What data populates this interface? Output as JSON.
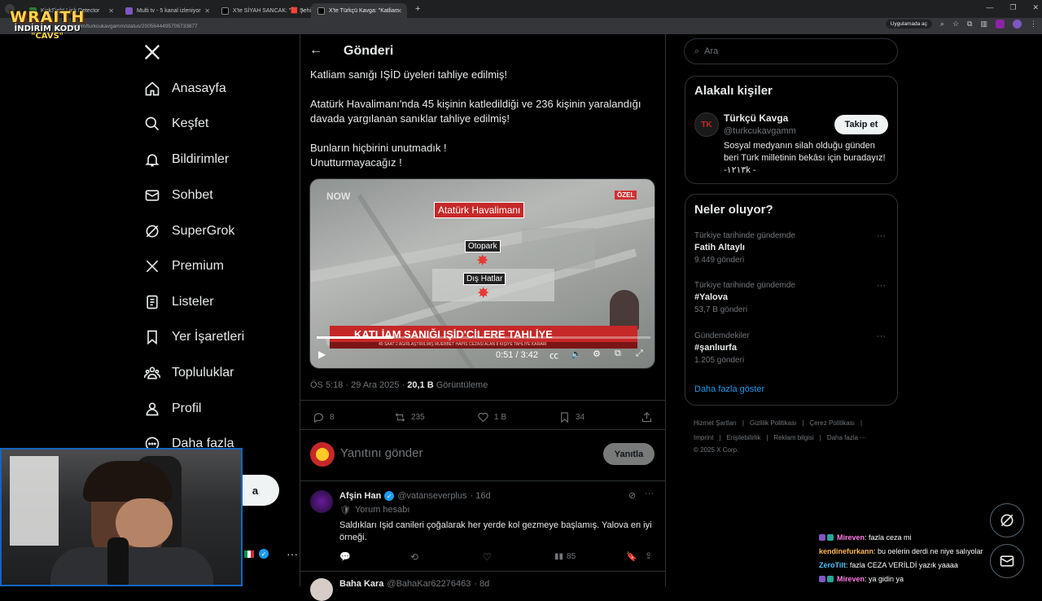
{
  "browser": {
    "tabs": [
      {
        "title": "KickSight Link Detector",
        "color": "#2e7d32"
      },
      {
        "title": "Multi tv - 5 kanal izleniyor",
        "color": "#7e57c2"
      },
      {
        "title": "X'te SİYAH SANCAK: \"🟥 Şehit",
        "color": "#000000"
      },
      {
        "title": "X'te Türkçü Kavga: \"Katliam",
        "color": "#000000"
      }
    ],
    "url": "x.com/turkcukavgamm/status/2005644495706733877",
    "open_app_label": "Uygulamada aç"
  },
  "overlay": {
    "brand": "WRAITH",
    "promo_line": "İNDİRİM KODU",
    "promo_code": "\"CAVS\""
  },
  "nav": {
    "items": [
      {
        "label": "Anasayfa",
        "icon": "home-icon"
      },
      {
        "label": "Keşfet",
        "icon": "search-icon"
      },
      {
        "label": "Bildirimler",
        "icon": "bell-icon"
      },
      {
        "label": "Sohbet",
        "icon": "mail-icon"
      },
      {
        "label": "SuperGrok",
        "icon": "grok-icon"
      },
      {
        "label": "Premium",
        "icon": "x-logo-icon"
      },
      {
        "label": "Listeler",
        "icon": "list-icon"
      },
      {
        "label": "Yer İşaretleri",
        "icon": "bookmark-icon"
      },
      {
        "label": "Topluluklar",
        "icon": "community-icon"
      },
      {
        "label": "Profil",
        "icon": "profile-icon"
      },
      {
        "label": "Daha fazla",
        "icon": "more-icon"
      }
    ],
    "post_button_partial": "a"
  },
  "post": {
    "header_title": "Gönderi",
    "line1": "Katliam sanığı IŞİD üyeleri tahliye edilmiş!",
    "line2": "Atatürk Havalimanı'nda 45 kişinin katledildiği ve 236 kişinin yaralandığı davada yargılanan sanıklar tahliye edilmiş!",
    "line3": "Bunların hiçbirini unutmadık !",
    "line4": "Unutturmayacağız !",
    "video": {
      "channel": "NOW",
      "badge": "ÖZEL",
      "label_airport": "Atatürk Havalimanı",
      "label_parking": "Otopark",
      "label_intl": "Dış Hatlar",
      "headline": "KATLİAM SANIĞI IŞİD'CİLERE TAHLİYE",
      "subheadline": "40 SAAT 2 AĞIRLAŞTIRILMIŞ MÜEBBET HAPİS CEZASI ALAN 8 KİŞİYE TAHLİYE KARARI",
      "time": "0:51 / 3:42",
      "progress": 0.23
    },
    "timestamp": "ÖS 5:18 · 29 Ara 2025 · ",
    "views": "20,1 B",
    "views_label": " Görüntüleme",
    "actions": {
      "replies": "8",
      "reposts": "235",
      "likes": "1 B",
      "bookmarks": "34"
    },
    "reply_placeholder": "Yanıtını gönder",
    "reply_button": "Yanıtla"
  },
  "replies": [
    {
      "name": "Afşin Han",
      "handle": "@vatanseverplus",
      "time": "· 16d",
      "note": "Yorum hesabı",
      "text": "Saldıkları Işid canileri çoğalarak her yerde kol gezmeye başlamış. Yalova en iyi örneği.",
      "views": "85"
    },
    {
      "name": "Baha Kara",
      "handle": "@BahaKar62276463",
      "time": "· 8d"
    }
  ],
  "search": {
    "placeholder": "Ara"
  },
  "related": {
    "title": "Alakalı kişiler",
    "name": "Türkçü Kavga",
    "handle": "@turkcukavgamm",
    "bio": "Sosyal medyanın silah olduğu günden beri Türk milletinin bekâsı için buradayız! -١٢١٣k -",
    "follow": "Takip et",
    "avatar_text": "TK"
  },
  "trends": {
    "title": "Neler oluyor?",
    "items": [
      {
        "category": "Türkiye tarihinde gündemde",
        "name": "Fatih Altaylı",
        "count": "9.449 gönderi"
      },
      {
        "category": "Türkiye tarihinde gündemde",
        "name": "#Yalova",
        "count": "53,7 B gönderi"
      },
      {
        "category": "Gündemdekiler",
        "name": "#şanlıurfa",
        "count": "1.205 gönderi"
      }
    ],
    "show_more": "Daha fazla göster"
  },
  "footer": {
    "row1": [
      "Hizmet Şartları",
      "Gizlilik Politikası",
      "Çerez Politikası"
    ],
    "row2": [
      "Imprint",
      "Erişilebilirlik",
      "Reklam bilgisi",
      "Daha fazla ···"
    ],
    "copyright": "© 2025 X Corp."
  },
  "chat": [
    {
      "user": "Mireven",
      "color": "#ff7be6",
      "msg": ": fazla ceza mi"
    },
    {
      "user": "kendinefurkann",
      "color": "#ffb74d",
      "msg": ": bu oelerin derdi ne niye salıyolar"
    },
    {
      "user": "ZeroTilt",
      "color": "#4fc3f7",
      "msg": ": fazla CEZA VERİLDİ yazık yaaaa"
    },
    {
      "user": "Mireven",
      "color": "#ff7be6",
      "msg": ": ya gidin ya"
    }
  ]
}
